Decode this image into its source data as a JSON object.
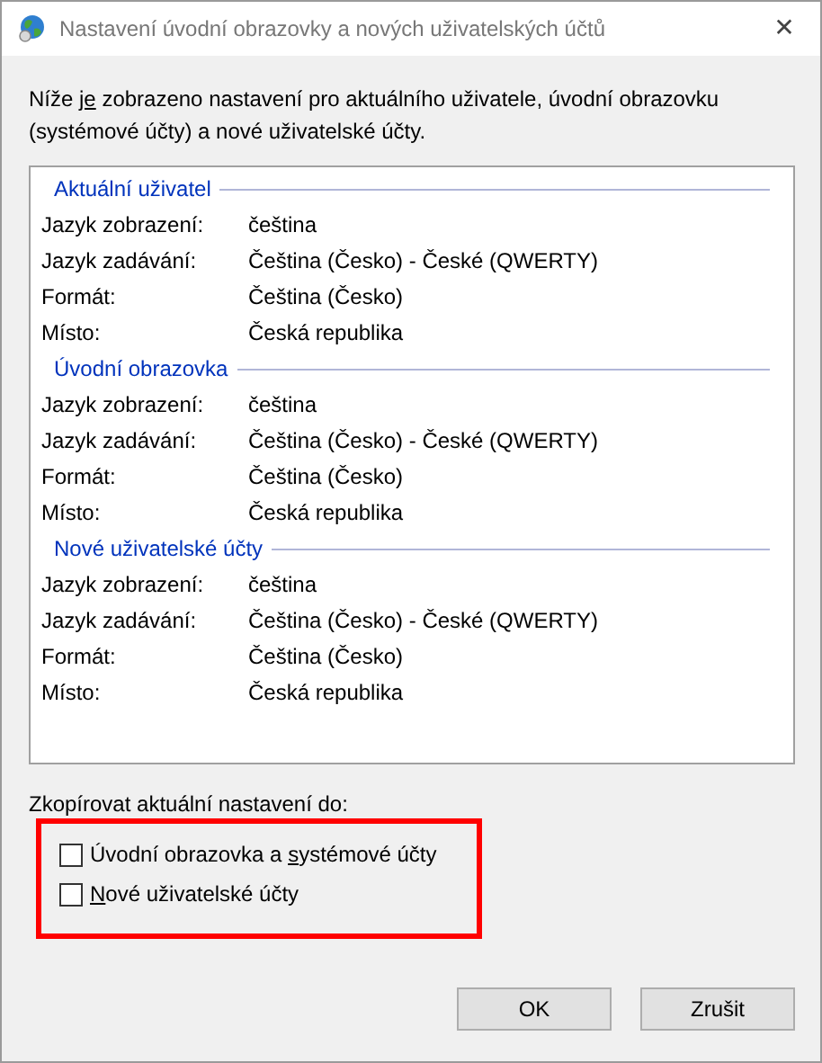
{
  "window": {
    "title": "Nastavení úvodní obrazovky a nových uživatelských účtů",
    "close": "✕"
  },
  "intro": {
    "before": "Níže ",
    "key": "je",
    "after": " zobrazeno nastavení pro aktuálního uživatele, úvodní obrazovku (systémové účty) a nové uživatelské účty."
  },
  "sections": [
    {
      "heading": "Aktuální uživatel",
      "rows": [
        {
          "label": "Jazyk zobrazení:",
          "value": "čeština"
        },
        {
          "label": "Jazyk zadávání:",
          "value": "Čeština (Česko) - České (QWERTY)"
        },
        {
          "label": "Formát:",
          "value": "Čeština (Česko)"
        },
        {
          "label": "Místo:",
          "value": "Česká republika"
        }
      ]
    },
    {
      "heading": "Úvodní obrazovka",
      "rows": [
        {
          "label": "Jazyk zobrazení:",
          "value": "čeština"
        },
        {
          "label": "Jazyk zadávání:",
          "value": "Čeština (Česko) - České (QWERTY)"
        },
        {
          "label": "Formát:",
          "value": "Čeština (Česko)"
        },
        {
          "label": "Místo:",
          "value": "Česká republika"
        }
      ]
    },
    {
      "heading": "Nové uživatelské účty",
      "rows": [
        {
          "label": "Jazyk zobrazení:",
          "value": "čeština"
        },
        {
          "label": "Jazyk zadávání:",
          "value": "Čeština (Česko) - České (QWERTY)"
        },
        {
          "label": "Formát:",
          "value": "Čeština (Česko)"
        },
        {
          "label": "Místo:",
          "value": "Česká republika"
        }
      ]
    }
  ],
  "copy": {
    "label": "Zkopírovat aktuální nastavení do:",
    "options": [
      {
        "before": "Úvodní obrazovka a ",
        "key": "s",
        "after": "ystémové účty",
        "checked": false
      },
      {
        "key": "N",
        "after": "ové uživatelské účty",
        "checked": false
      }
    ]
  },
  "highlight": {
    "color": "#ff0000"
  },
  "buttons": [
    "OK",
    "Zrušit"
  ]
}
